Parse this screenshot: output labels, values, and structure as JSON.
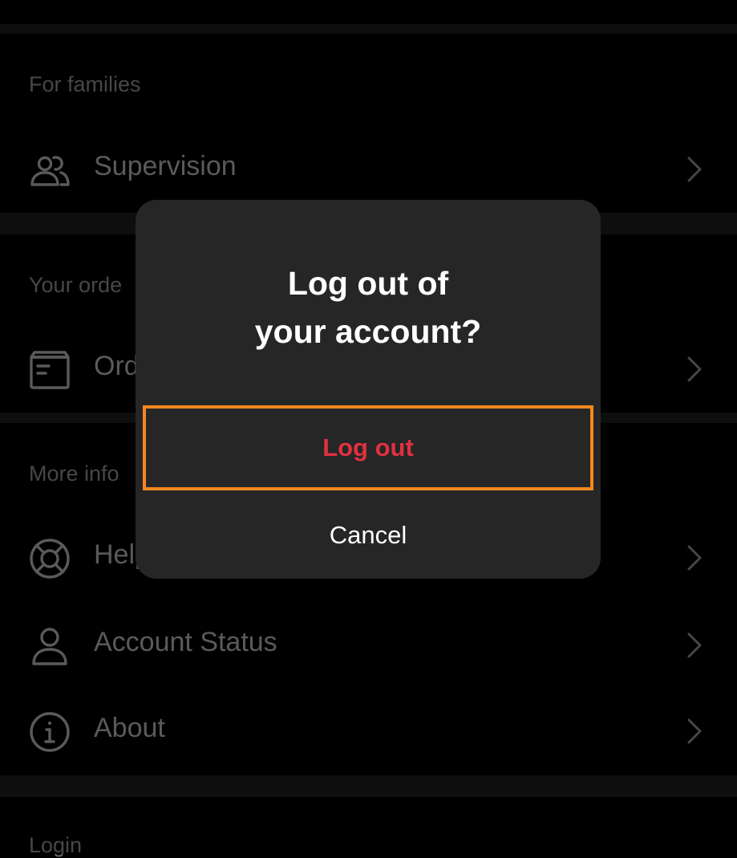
{
  "sections": {
    "families": {
      "header": "For families",
      "items": [
        {
          "label": "Supervision",
          "icon": "people-icon"
        }
      ]
    },
    "orders": {
      "header": "Your orde",
      "items": [
        {
          "label": "Ord",
          "icon": "box-icon"
        }
      ]
    },
    "info": {
      "header": "More info",
      "items": [
        {
          "label": "Help",
          "icon": "lifebuoy-icon"
        },
        {
          "label": "Account Status",
          "icon": "person-icon"
        },
        {
          "label": "About",
          "icon": "info-icon"
        }
      ]
    },
    "login": {
      "header": "Login"
    }
  },
  "dialog": {
    "title_line1": "Log out of",
    "title_line2": "your account?",
    "logout_label": "Log out",
    "cancel_label": "Cancel"
  },
  "colors": {
    "background": "#000000",
    "dialog": "#262626",
    "destructive": "#e0313f",
    "highlight": "#f5871f"
  }
}
